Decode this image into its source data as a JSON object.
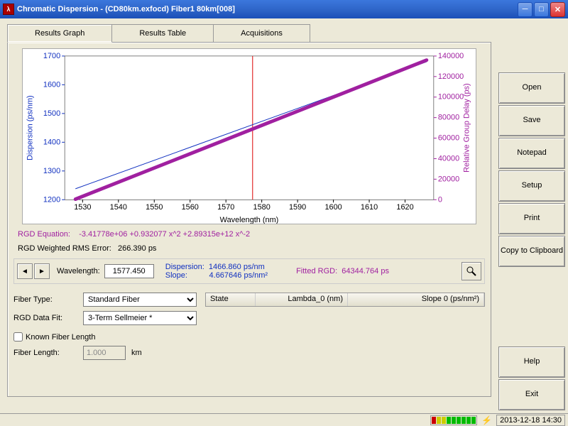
{
  "window": {
    "title": "Chromatic Dispersion - (CD80km.exfocd) Fiber1 80km[008]",
    "app_glyph": "λ"
  },
  "tabs": {
    "graph": "Results Graph",
    "table": "Results Table",
    "acq": "Acquisitions"
  },
  "sidebar": {
    "open": "Open",
    "save": "Save",
    "notepad": "Notepad",
    "setup": "Setup",
    "print": "Print",
    "copy": "Copy to Clipboard",
    "help": "Help",
    "exit": "Exit"
  },
  "equation": {
    "label": "RGD Equation:",
    "value": "-3.41778e+06 +0.932077 x^2 +2.89315e+12 x^-2",
    "rms_label": "RGD Weighted RMS Error:",
    "rms_value": "266.390 ps"
  },
  "wl": {
    "label": "Wavelength:",
    "value": "1577.450",
    "disp_label": "Dispersion:",
    "disp_value": "1466.860 ps/nm",
    "slope_label": "Slope:",
    "slope_value": "4.667646 ps/nm²",
    "fitted_label": "Fitted RGD:",
    "fitted_value": "64344.764 ps"
  },
  "fiber": {
    "type_label": "Fiber Type:",
    "type_value": "Standard Fiber",
    "fit_label": "RGD Data Fit:",
    "fit_value": "3-Term Sellmeier *",
    "known_label": "Known Fiber Length",
    "length_label": "Fiber Length:",
    "length_value": "1.000",
    "length_unit": "km"
  },
  "table": {
    "state": "State",
    "lambda": "Lambda_0 (nm)",
    "slope": "Slope 0 (ps/nm²)"
  },
  "status": {
    "datetime": "2013-12-18 14:30"
  },
  "chart_data": {
    "type": "line",
    "xlabel": "Wavelength (nm)",
    "ylabel_left": "Dispersion (ps/nm)",
    "ylabel_right": "Relative Group Delay (ps)",
    "xlim": [
      1525,
      1628
    ],
    "ylim_left": [
      1200,
      1700
    ],
    "ylim_right": [
      0,
      140000
    ],
    "xticks": [
      1530,
      1540,
      1550,
      1560,
      1570,
      1580,
      1590,
      1600,
      1610,
      1620
    ],
    "yticks_left": [
      1200,
      1300,
      1400,
      1500,
      1600,
      1700
    ],
    "yticks_right": [
      0,
      20000,
      40000,
      60000,
      80000,
      100000,
      120000,
      140000
    ],
    "marker_x": 1577.45,
    "series": [
      {
        "name": "Dispersion",
        "axis": "left",
        "color": "#1030c0",
        "points": [
          [
            1528,
            1238
          ],
          [
            1626,
            1680
          ]
        ]
      },
      {
        "name": "RGD",
        "axis": "right",
        "color": "#a020a0",
        "points": [
          [
            1528,
            500
          ],
          [
            1626,
            136000
          ]
        ]
      }
    ]
  }
}
